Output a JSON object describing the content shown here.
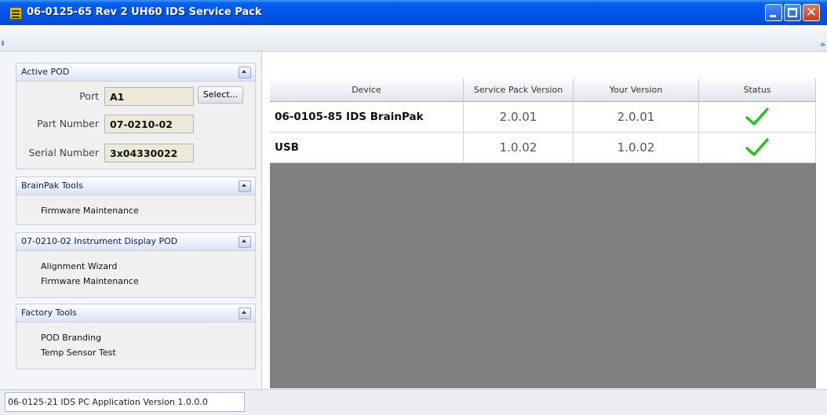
{
  "window": {
    "title": "06-0125-65 Rev 2 UH60 IDS Service Pack"
  },
  "active_pod": {
    "header": "Active POD",
    "port_label": "Port",
    "port_value": "A1",
    "select_label": "Select...",
    "part_number_label": "Part Number",
    "part_number_value": "07-0210-02",
    "serial_number_label": "Serial Number",
    "serial_number_value": "3x04330022"
  },
  "brainpak_tools": {
    "header": "BrainPak Tools",
    "items": [
      "Firmware Maintenance"
    ]
  },
  "instrument_pod": {
    "header": "07-0210-02 Instrument Display POD",
    "items": [
      "Alignment Wizard",
      "Firmware Maintenance"
    ]
  },
  "factory_tools": {
    "header": "Factory Tools",
    "items": [
      "POD Branding",
      "Temp Sensor Test"
    ]
  },
  "grid": {
    "columns": [
      "Device",
      "Service Pack Version",
      "Your Version",
      "Status"
    ],
    "rows": [
      {
        "device": "06-0105-85 IDS BrainPak",
        "service_pack_version": "2.0.01",
        "your_version": "2.0.01",
        "status_icon": "check-icon"
      },
      {
        "device": "USB",
        "service_pack_version": "1.0.02",
        "your_version": "1.0.02",
        "status_icon": "check-icon"
      }
    ]
  },
  "status_bar": {
    "text": "06-0125-21 IDS PC Application Version 1.0.0.0"
  },
  "colors": {
    "titlebar": "#0054e3",
    "check": "#22c020",
    "grid_background": "#808080"
  }
}
